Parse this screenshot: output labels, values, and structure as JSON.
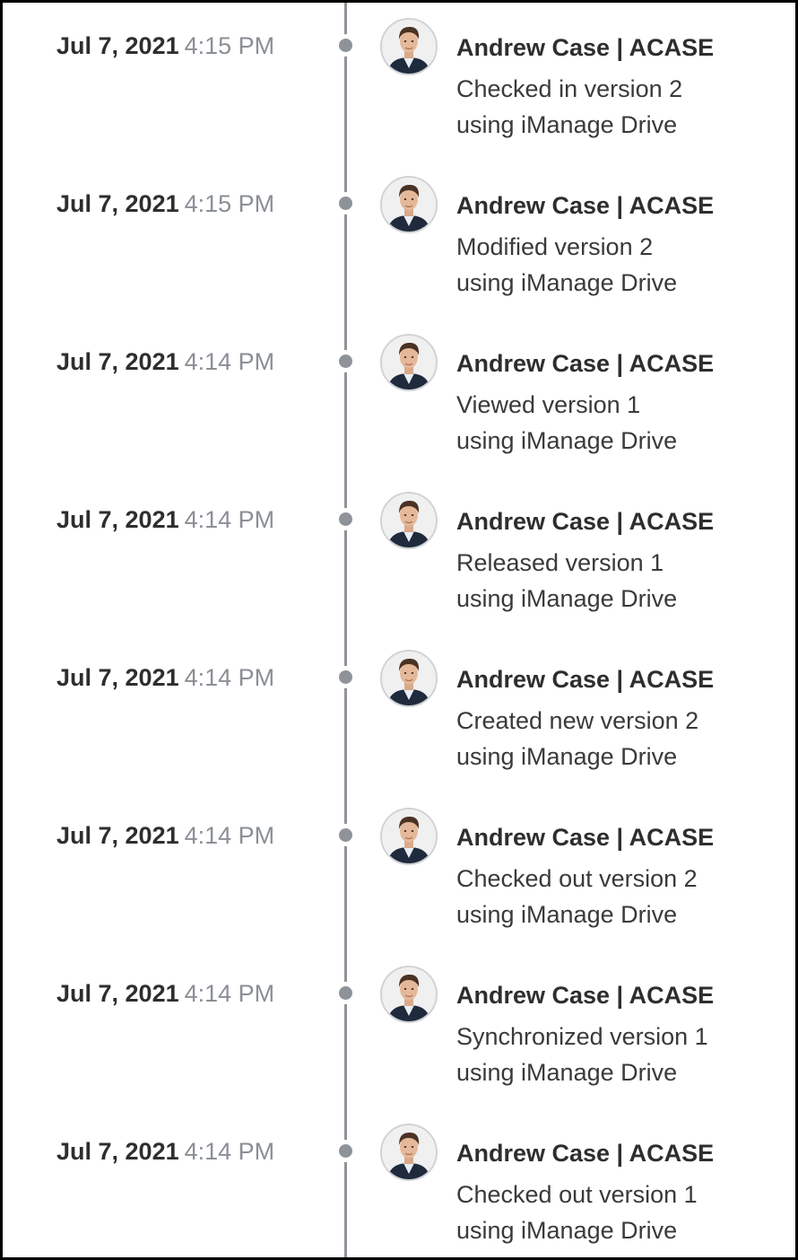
{
  "timeline": {
    "entries": [
      {
        "date": "Jul 7, 2021",
        "time": "4:15 PM",
        "user": "Andrew Case | ACASE",
        "action": "Checked in version 2",
        "via": "using iManage Drive"
      },
      {
        "date": "Jul 7, 2021",
        "time": "4:15 PM",
        "user": "Andrew Case | ACASE",
        "action": "Modified version 2",
        "via": "using iManage Drive"
      },
      {
        "date": "Jul 7, 2021",
        "time": "4:14 PM",
        "user": "Andrew Case | ACASE",
        "action": "Viewed version 1",
        "via": "using iManage Drive"
      },
      {
        "date": "Jul 7, 2021",
        "time": "4:14 PM",
        "user": "Andrew Case | ACASE",
        "action": "Released version 1",
        "via": "using iManage Drive"
      },
      {
        "date": "Jul 7, 2021",
        "time": "4:14 PM",
        "user": "Andrew Case | ACASE",
        "action": "Created new version 2",
        "via": "using iManage Drive"
      },
      {
        "date": "Jul 7, 2021",
        "time": "4:14 PM",
        "user": "Andrew Case | ACASE",
        "action": "Checked out version 2",
        "via": "using iManage Drive"
      },
      {
        "date": "Jul 7, 2021",
        "time": "4:14 PM",
        "user": "Andrew Case | ACASE",
        "action": "Synchronized version 1",
        "via": "using iManage Drive"
      },
      {
        "date": "Jul 7, 2021",
        "time": "4:14 PM",
        "user": "Andrew Case | ACASE",
        "action": "Checked out version 1",
        "via": "using iManage Drive"
      }
    ],
    "icons": {
      "avatar": "user-avatar-icon",
      "marker": "timeline-dot-icon"
    },
    "colors": {
      "line": "#8e9399",
      "date": "#2e2e2e",
      "time": "#8a8f96",
      "text": "#3a3a3a"
    }
  }
}
